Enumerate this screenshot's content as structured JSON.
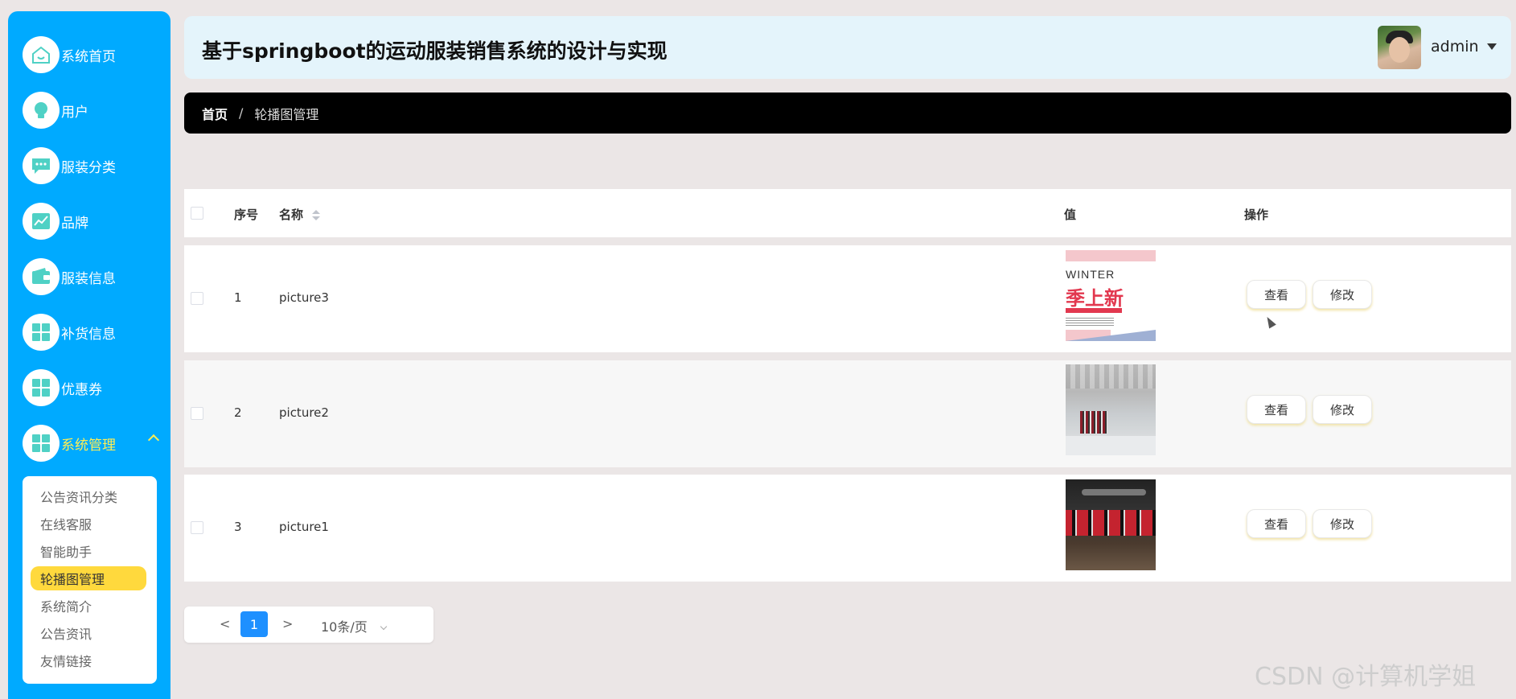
{
  "header": {
    "title": "基于springboot的运动服装销售系统的设计与实现",
    "username": "admin"
  },
  "sidebar": {
    "items": [
      {
        "label": "系统首页",
        "icon": "home-icon"
      },
      {
        "label": "用户",
        "icon": "bulb-icon"
      },
      {
        "label": "服装分类",
        "icon": "chat-icon"
      },
      {
        "label": "品牌",
        "icon": "chart-icon"
      },
      {
        "label": "服装信息",
        "icon": "wallet-icon"
      },
      {
        "label": "补货信息",
        "icon": "grid-icon"
      },
      {
        "label": "优惠券",
        "icon": "grid-icon"
      },
      {
        "label": "系统管理",
        "icon": "grid-icon"
      }
    ],
    "submenu": [
      "公告资讯分类",
      "在线客服",
      "智能助手",
      "轮播图管理",
      "系统简介",
      "公告资讯",
      "友情链接"
    ]
  },
  "breadcrumb": {
    "home": "首页",
    "separator": "/",
    "current": "轮播图管理"
  },
  "table": {
    "headers": {
      "index": "序号",
      "name": "名称",
      "value": "值",
      "actions": "操作"
    },
    "rows": [
      {
        "index": "1",
        "name": "picture3",
        "thumb_text_1": "WINTER",
        "thumb_text_2": "季上新"
      },
      {
        "index": "2",
        "name": "picture2"
      },
      {
        "index": "3",
        "name": "picture1"
      }
    ],
    "view_label": "查看",
    "edit_label": "修改"
  },
  "pagination": {
    "prev": "<",
    "current_page": "1",
    "next": ">",
    "page_size": "10条/页"
  },
  "watermark": "CSDN @计算机学姐",
  "colors": {
    "sidebar_bg": "#00aaff",
    "active_text": "#ffee55",
    "active_submenu": "#ffd93d",
    "header_bg": "#e4f4fb",
    "breadcrumb_bg": "#000000",
    "page_active": "#1e90ff"
  }
}
